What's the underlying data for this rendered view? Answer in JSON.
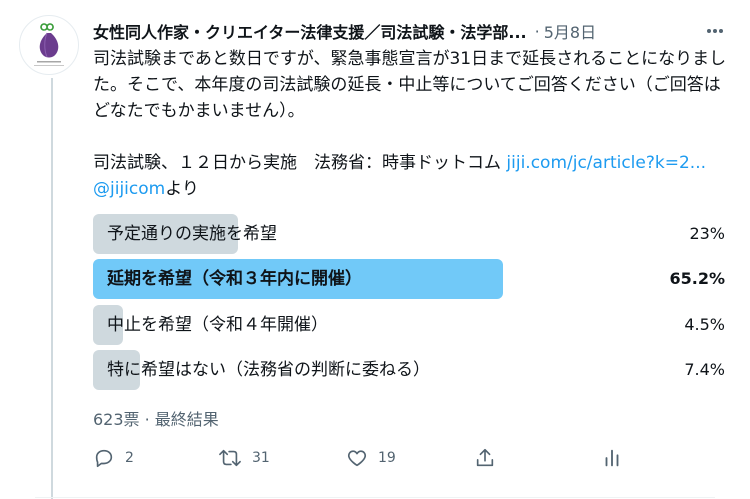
{
  "tweet": {
    "author": "女性同人作家・クリエイター法律支援／司法試験・法学部...",
    "separator": "·",
    "date": "5月8日",
    "text_p1": "司法試験まであと数日ですが、緊急事態宣言が31日まで延長されることになりました。そこで、本年度の司法試験の延長・中止等についてご回答ください（ご回答はどなたでもかまいません）。",
    "text_p2_prefix": "司法試験、１２日から実施　法務省：時事ドットコム ",
    "text_p2_link": "jiji.com/jc/article?k=2...",
    "text_p2_space": " ",
    "text_p2_mention": "@jijicom",
    "text_p2_suffix": "より"
  },
  "poll": {
    "options": [
      {
        "label": "予定通りの実施を希望",
        "percent_text": "23%",
        "percent": 23,
        "winner": false
      },
      {
        "label": "延期を希望（令和３年内に開催）",
        "percent_text": "65.2%",
        "percent": 65.2,
        "winner": true
      },
      {
        "label": "中止を希望（令和４年開催）",
        "percent_text": "4.5%",
        "percent": 4.5,
        "winner": false
      },
      {
        "label": "特に希望はない（法務省の判断に委ねる）",
        "percent_text": "7.4%",
        "percent": 7.4,
        "winner": false
      }
    ],
    "summary": "623票 · 最終結果"
  },
  "actions": {
    "reply_count": "2",
    "retweet_count": "31",
    "like_count": "19"
  },
  "icons": [
    "avatar-logo",
    "more-icon",
    "reply-icon",
    "retweet-icon",
    "like-icon",
    "share-icon",
    "analytics-icon"
  ],
  "colors": {
    "winner_bar": "#71c9f8",
    "bar": "#cfd9de",
    "link": "#1d9bf0",
    "secondary_text": "#536471"
  }
}
